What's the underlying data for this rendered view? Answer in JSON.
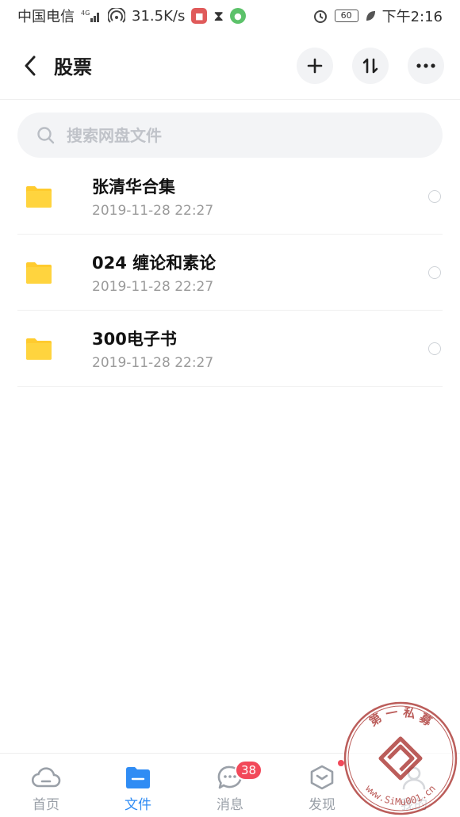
{
  "status_bar": {
    "carrier": "中国电信",
    "network": "4G",
    "speed": "31.5K/s",
    "battery": "60",
    "time": "下午2:16"
  },
  "header": {
    "title": "股票"
  },
  "search": {
    "placeholder": "搜索网盘文件"
  },
  "files": [
    {
      "name": "张清华合集",
      "date": "2019-11-28  22:27"
    },
    {
      "name": "024 缠论和素论",
      "date": "2019-11-28  22:27"
    },
    {
      "name": "300电子书",
      "date": "2019-11-28  22:27"
    }
  ],
  "bottom_nav": {
    "items": [
      {
        "label": "首页"
      },
      {
        "label": "文件"
      },
      {
        "label": "消息"
      },
      {
        "label": "发现"
      },
      {
        "label": "我的"
      }
    ],
    "messages_badge": "38"
  },
  "watermark": {
    "text_top": "第 一 私 募",
    "text_bottom": "www.SiMu001.cn"
  },
  "colors": {
    "accent": "#2f8cf4",
    "folder": "#ffcb2e",
    "badge": "#f2495a",
    "inactive": "#9aa0a8"
  }
}
